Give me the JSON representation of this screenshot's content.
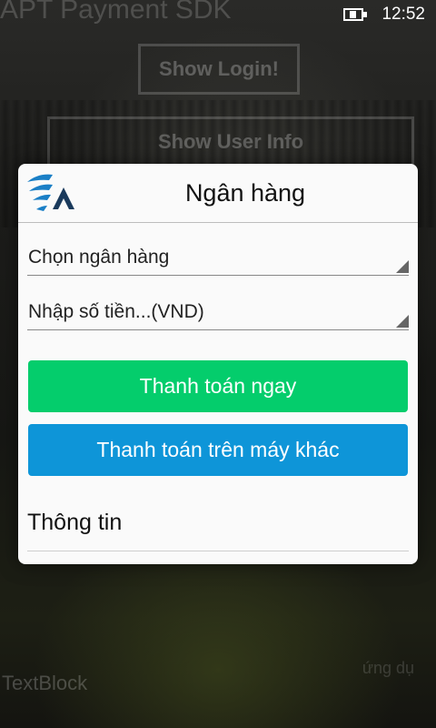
{
  "status_bar": {
    "time": "12:52"
  },
  "background": {
    "app_title": "APT Payment SDK",
    "buttons": [
      "Show Login!",
      "Show User Info"
    ],
    "textblock": "TextBlock",
    "right_text": "ứng dụ"
  },
  "dialog": {
    "title": "Ngân hàng",
    "bank_select": {
      "value": "Chọn ngân hàng"
    },
    "amount_input": {
      "placeholder": "Nhập số tiền...(VND)"
    },
    "pay_now_label": "Thanh toán ngay",
    "pay_other_device_label": "Thanh toán trên máy khác",
    "info_title": "Thông tin"
  },
  "colors": {
    "pay_now": "#04cd6c",
    "pay_other_device": "#0e95d8",
    "logo_blue": "#1a7fc6"
  }
}
